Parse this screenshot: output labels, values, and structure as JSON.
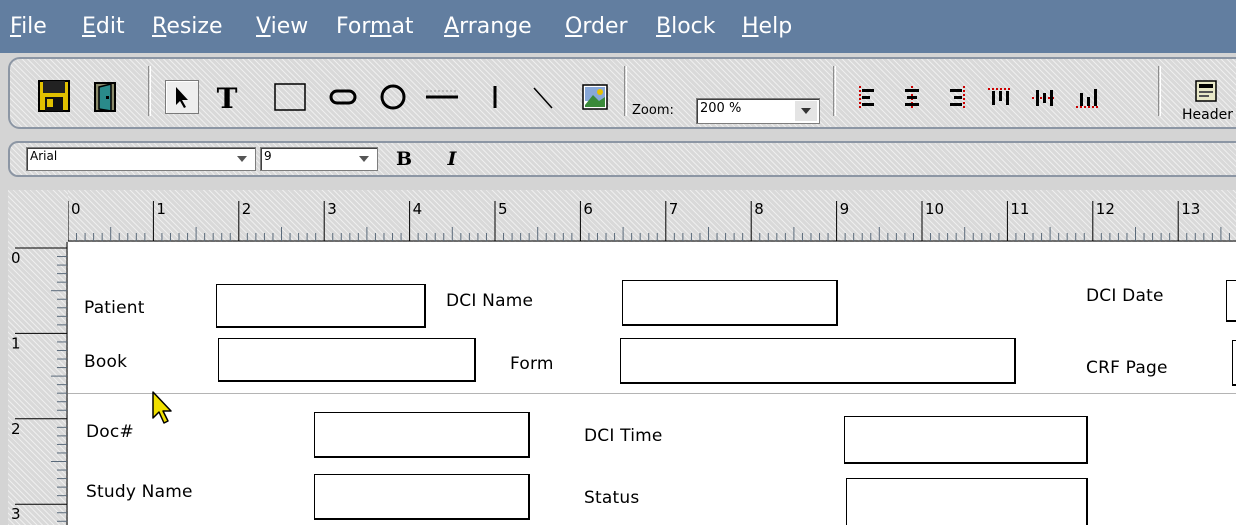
{
  "menu": [
    {
      "u": "F",
      "rest": "ile"
    },
    {
      "u": "E",
      "rest": "dit"
    },
    {
      "u": "R",
      "rest": "esize"
    },
    {
      "u": "V",
      "rest": "iew"
    },
    {
      "pre": "For",
      "u": "m",
      "rest": "at"
    },
    {
      "u": "A",
      "rest": "rrange"
    },
    {
      "u": "O",
      "rest": "rder"
    },
    {
      "u": "B",
      "rest": "lock"
    },
    {
      "u": "H",
      "rest": "elp"
    }
  ],
  "toolbar": {
    "zoom_label": "Zoom:",
    "zoom_value": "200 %",
    "header_label": "Header"
  },
  "format_bar": {
    "font_value": "Arial",
    "size_value": "9",
    "bold_label": "B",
    "italic_label": "I"
  },
  "ruler": {
    "horizontal": [
      "0",
      "1",
      "2",
      "3",
      "4",
      "5",
      "6",
      "7",
      "8",
      "9",
      "10",
      "11",
      "12",
      "13"
    ],
    "vertical": [
      "0",
      "1",
      "2",
      "3"
    ]
  },
  "form": {
    "patient_label": "Patient",
    "dci_name_label": "DCI Name",
    "dci_date_label": "DCI Date",
    "book_label": "Book",
    "form_label": "Form",
    "crf_page_label": "CRF Page",
    "doc_label": "Doc#",
    "dci_time_label": "DCI Time",
    "study_name_label": "Study Name",
    "status_label": "Status"
  },
  "colors": {
    "menubar": "#627ea0",
    "save_icon": "#e0c000",
    "align_icons": "#cc0000"
  }
}
